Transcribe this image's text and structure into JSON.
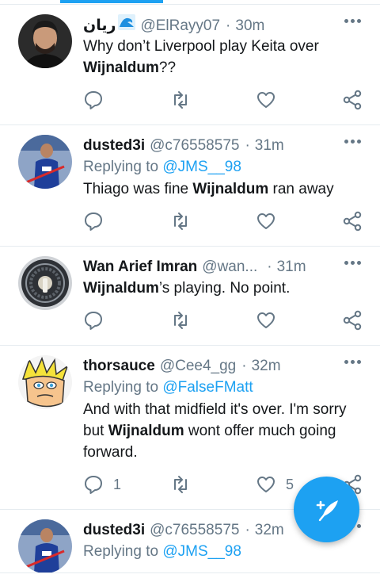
{
  "theme": {
    "accent": "#1da1f2",
    "text": "#14171a",
    "muted": "#657786",
    "divider": "#e6ecf0"
  },
  "tweets": [
    {
      "name": "ريان",
      "name_emoji": "water-wave-emoji",
      "handle": "@ElRayy07",
      "time": "30m",
      "reply_label": "",
      "reply_to": "",
      "text": [
        {
          "t": "Why don’t Liverpool play Keita over ",
          "b": false
        },
        {
          "t": "Wijnaldum",
          "b": true
        },
        {
          "t": "??",
          "b": false
        }
      ],
      "reply_count": "",
      "like_count": ""
    },
    {
      "name": "dusted3i",
      "handle": "@c76558575",
      "time": "31m",
      "reply_label": "Replying to",
      "reply_to": "@JMS__98",
      "text": [
        {
          "t": "Thiago was fine ",
          "b": false
        },
        {
          "t": "Wijnaldum",
          "b": true
        },
        {
          "t": " ran away",
          "b": false
        }
      ],
      "reply_count": "",
      "like_count": ""
    },
    {
      "name": "Wan Arief Imran",
      "handle": "@wan...",
      "time": "31m",
      "reply_label": "",
      "reply_to": "",
      "text": [
        {
          "t": "Wijnaldum",
          "b": true
        },
        {
          "t": "’s playing. No point.",
          "b": false
        }
      ],
      "reply_count": "",
      "like_count": ""
    },
    {
      "name": "thorsauce",
      "handle": "@Cee4_gg",
      "time": "32m",
      "reply_label": "Replying to",
      "reply_to": "@FalseFMatt",
      "text": [
        {
          "t": "And with that midfield it's over. I'm sorry but ",
          "b": false
        },
        {
          "t": "Wijnaldum",
          "b": true
        },
        {
          "t": " wont offer much going forward.",
          "b": false
        }
      ],
      "reply_count": "1",
      "like_count": "5"
    },
    {
      "name": "dusted3i",
      "handle": "@c76558575",
      "time": "32m",
      "reply_label": "Replying to",
      "reply_to": "@JMS__98",
      "text": [],
      "reply_count": "",
      "like_count": ""
    }
  ],
  "icons": {
    "reply": "reply-icon",
    "retweet": "retweet-icon",
    "like": "like-icon",
    "share": "share-icon",
    "more": "more-icon",
    "compose": "compose-tweet-icon"
  }
}
